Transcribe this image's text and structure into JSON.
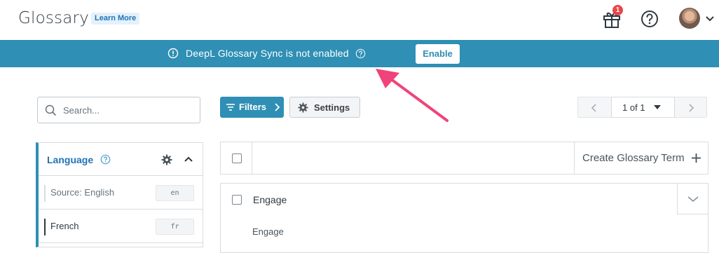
{
  "header": {
    "title": "Glossary",
    "learn_more": "Learn More",
    "notification_count": "1",
    "icons": [
      "gift-icon",
      "help-icon",
      "avatar",
      "chevron-down-icon"
    ]
  },
  "banner": {
    "message": "DeepL Glossary Sync is not enabled",
    "enable_label": "Enable",
    "color": "#2f8fb4"
  },
  "annotation": {
    "arrow_color": "#f0437a"
  },
  "sidebar": {
    "search_placeholder": "Search...",
    "language_panel": {
      "title": "Language",
      "rows": [
        {
          "name": "Source: English",
          "code": "en"
        },
        {
          "name": "French",
          "code": "fr"
        }
      ]
    }
  },
  "toolbar": {
    "filters_label": "Filters",
    "settings_label": "Settings",
    "pager_label": "1 of 1"
  },
  "table": {
    "create_label": "Create Glossary Term",
    "terms": [
      {
        "title": "Engage",
        "translation": "Engage"
      }
    ]
  }
}
